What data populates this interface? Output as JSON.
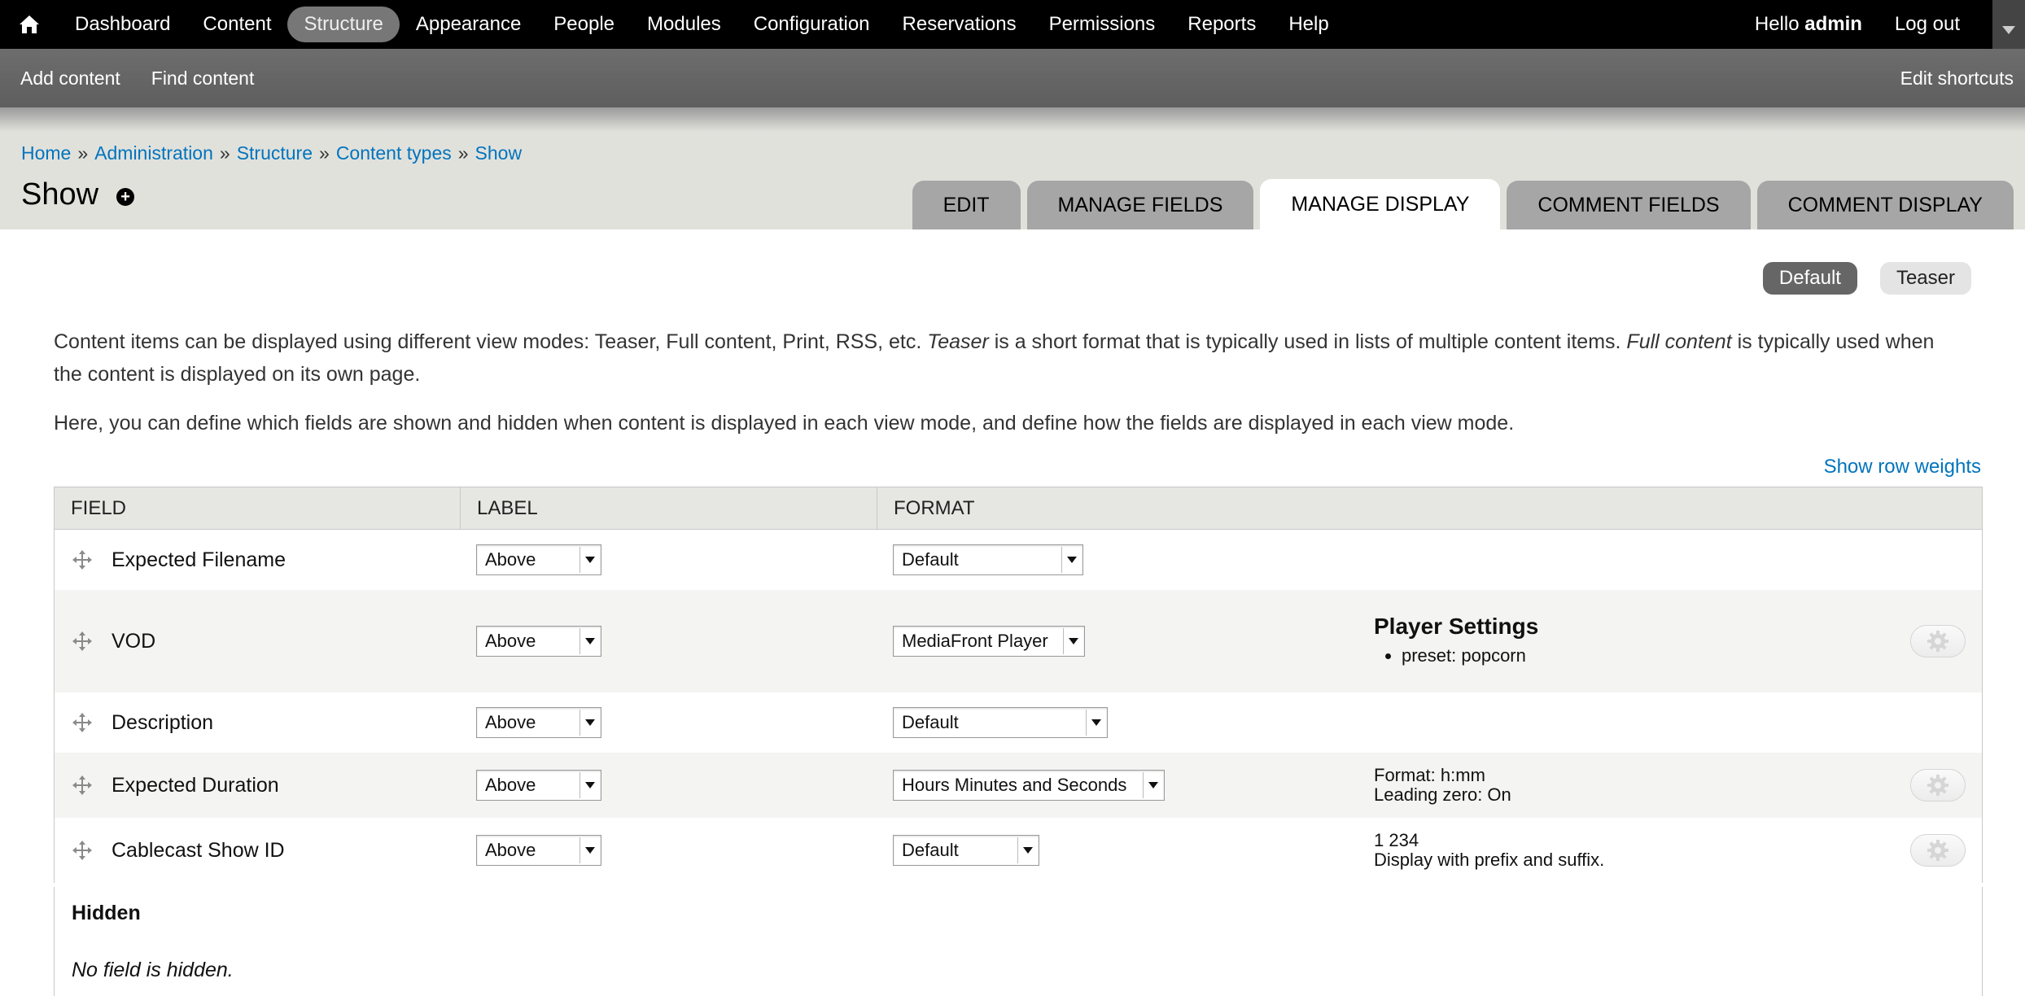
{
  "toolbar": {
    "menu": [
      "Dashboard",
      "Content",
      "Structure",
      "Appearance",
      "People",
      "Modules",
      "Configuration",
      "Reservations",
      "Permissions",
      "Reports",
      "Help"
    ],
    "active": "Structure",
    "hello_prefix": "Hello",
    "username": "admin",
    "logout": "Log out"
  },
  "shortcuts": {
    "items": [
      "Add content",
      "Find content"
    ],
    "edit": "Edit shortcuts"
  },
  "breadcrumb": [
    "Home",
    "Administration",
    "Structure",
    "Content types",
    "Show"
  ],
  "breadcrumb_sep": "»",
  "page_title": "Show",
  "tabs": [
    {
      "label": "Edit",
      "active": false
    },
    {
      "label": "Manage fields",
      "active": false
    },
    {
      "label": "Manage display",
      "active": true
    },
    {
      "label": "Comment fields",
      "active": false
    },
    {
      "label": "Comment display",
      "active": false
    }
  ],
  "view_modes": [
    {
      "label": "Default",
      "active": true
    },
    {
      "label": "Teaser",
      "active": false
    }
  ],
  "help": {
    "p1_a": "Content items can be displayed using different view modes: Teaser, Full content, Print, RSS, etc. ",
    "p1_em1": "Teaser",
    "p1_b": " is a short format that is typically used in lists of multiple content items. ",
    "p1_em2": "Full content",
    "p1_c": " is typically used when the content is displayed on its own page.",
    "p2": "Here, you can define which fields are shown and hidden when content is displayed in each view mode, and define how the fields are displayed in each view mode."
  },
  "show_row_weights": "Show row weights",
  "table": {
    "headers": [
      "FIELD",
      "LABEL",
      "FORMAT"
    ],
    "rows": [
      {
        "field": "Expected Filename",
        "label": "Above",
        "format": "Default",
        "summary": []
      },
      {
        "field": "VOD",
        "label": "Above",
        "format": "MediaFront Player",
        "summary_title": "Player Settings",
        "summary_list": [
          "preset: popcorn"
        ]
      },
      {
        "field": "Description",
        "label": "Above",
        "format": "Default",
        "summary": []
      },
      {
        "field": "Expected Duration",
        "label": "Above",
        "format": "Hours Minutes and Seconds",
        "summary": [
          "Format: h:mm",
          "Leading zero: On"
        ]
      },
      {
        "field": "Cablecast Show ID",
        "label": "Above",
        "format": "Default",
        "summary": [
          "1 234",
          "Display with prefix and suffix."
        ]
      }
    ],
    "hidden_heading": "Hidden",
    "hidden_message": "No field is hidden."
  }
}
